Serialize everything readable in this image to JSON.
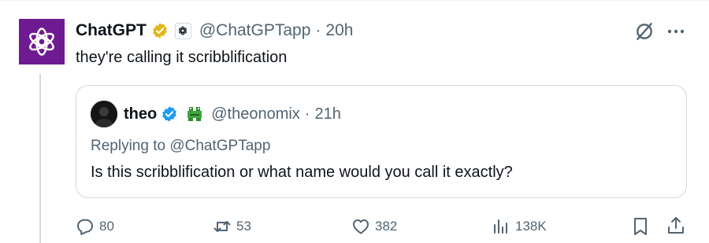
{
  "tweet": {
    "display_name": "ChatGPT",
    "handle": "@ChatGPTapp",
    "separator": "·",
    "time": "20h",
    "text": "they're calling it scribblification"
  },
  "quote": {
    "display_name": "theo",
    "handle": "@theonomix",
    "separator": "·",
    "time": "21h",
    "replying_prefix": "Replying to ",
    "replying_to": "@ChatGPTapp",
    "text": "Is this scribblification or what name would you call it exactly?"
  },
  "actions": {
    "replies": "80",
    "reposts": "53",
    "likes": "382",
    "views": "138K"
  },
  "icons": {
    "avatar": "openai-logo-icon",
    "verified_gold": "gold-verified-badge-icon",
    "affiliate": "openai-affiliate-badge-icon",
    "grok": "grok-icon",
    "more": "more-dots-icon",
    "verified_blue": "blue-verified-badge-icon",
    "emoji": "frog-emoji-icon",
    "reply": "reply-icon",
    "repost": "repost-icon",
    "like": "heart-icon",
    "views": "views-chart-icon",
    "bookmark": "bookmark-icon",
    "share": "share-icon"
  },
  "colors": {
    "brand_purple": "#6e1b92",
    "gold_badge": "#e2b719",
    "blue_badge": "#1d9bf0",
    "muted_text": "#536471",
    "border": "#cfd9de"
  }
}
